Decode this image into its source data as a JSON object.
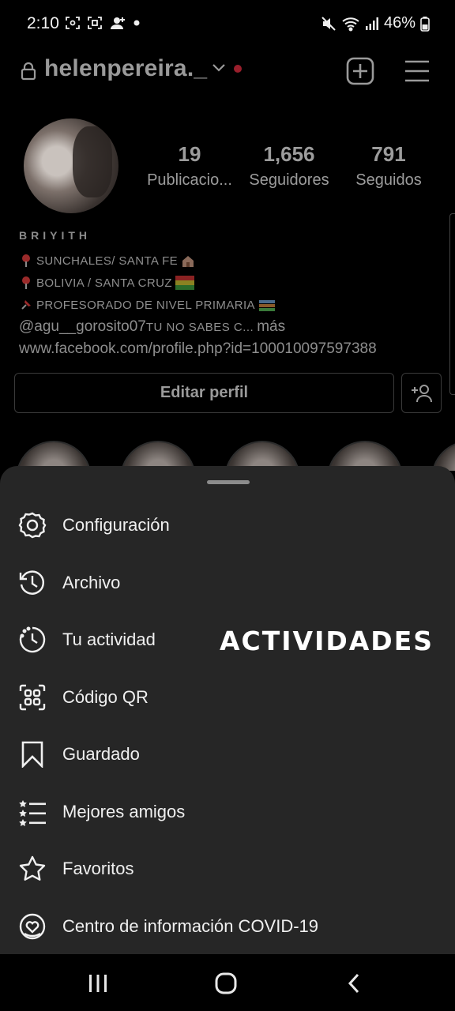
{
  "status_bar": {
    "time": "2:10",
    "battery_percent": "46%",
    "icons_left": [
      "screenshot-icon",
      "screenshot-icon",
      "person-add-icon",
      "dot-icon"
    ],
    "icons_right": [
      "mute-icon",
      "wifi-icon",
      "signal-icon",
      "battery-icon"
    ]
  },
  "header": {
    "username": "helenpereira._",
    "icons": [
      "lock-icon",
      "chevron-down-icon",
      "notification-dot",
      "new-post-icon",
      "menu-icon"
    ],
    "dot_color": "#9a1f2c"
  },
  "profile": {
    "stats": [
      {
        "value": "19",
        "label": "Publicacio..."
      },
      {
        "value": "1,656",
        "label": "Seguidores"
      },
      {
        "value": "791",
        "label": "Seguidos"
      }
    ],
    "bio": {
      "name": "BRIYITH",
      "line1": "SUNCHALES/ SANTA FE",
      "line2": "BOLIVIA / SANTA CRUZ",
      "line3": "PROFESORADO DE NIVEL PRIMARIA",
      "line4_mention": "@agu__gorosito07",
      "line4_text": "TU NO SABES C...",
      "line4_more": " más",
      "link": "www.facebook.com/profile.php?id=100010097597388"
    },
    "edit_button": "Editar perfil"
  },
  "sheet": {
    "items": [
      {
        "label": "Configuración",
        "icon": "settings-icon"
      },
      {
        "label": "Archivo",
        "icon": "archive-icon"
      },
      {
        "label": "Tu actividad",
        "icon": "activity-icon"
      },
      {
        "label": "Código QR",
        "icon": "qr-code-icon"
      },
      {
        "label": "Guardado",
        "icon": "bookmark-icon"
      },
      {
        "label": "Mejores amigos",
        "icon": "close-friends-icon"
      },
      {
        "label": "Favoritos",
        "icon": "star-icon"
      },
      {
        "label": "Centro de información COVID-19",
        "icon": "covid-info-icon"
      }
    ],
    "overlay_caption": "ACTIVIDADES"
  },
  "navbar": {
    "icons": [
      "recent-apps-icon",
      "home-icon",
      "back-icon"
    ]
  }
}
